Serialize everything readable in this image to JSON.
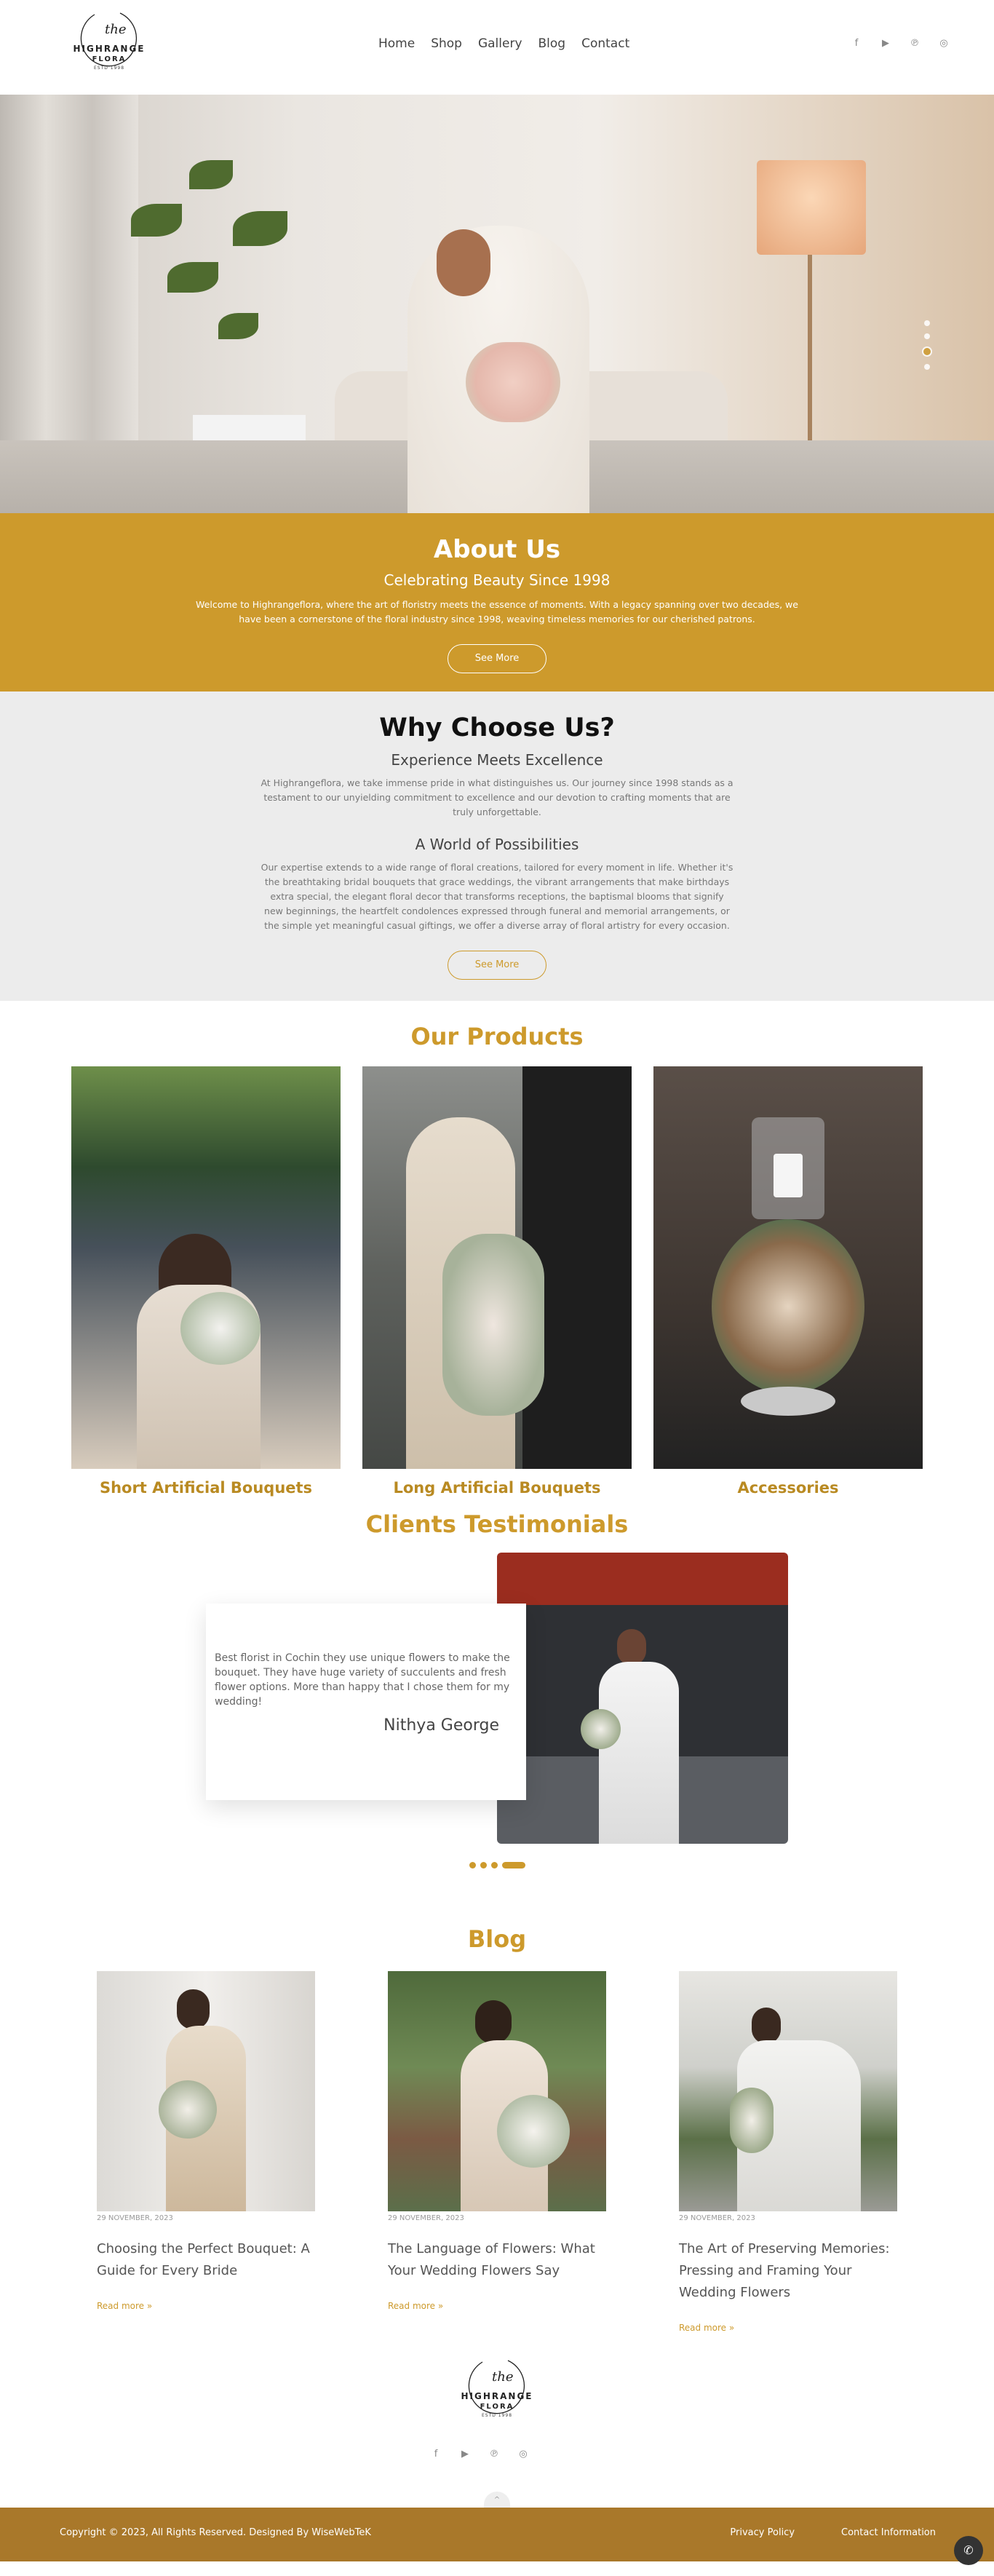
{
  "brand": {
    "line1": "HIGHRANGE",
    "line2": "FLORA",
    "line3": "ESTD 1998",
    "script": "the"
  },
  "nav": {
    "items": [
      "Home",
      "Shop",
      "Gallery",
      "Blog",
      "Contact"
    ]
  },
  "social": {
    "icons": [
      "facebook-icon",
      "youtube-icon",
      "pinterest-icon",
      "instagram-icon"
    ],
    "glyphs": [
      "f",
      "▶",
      "℗",
      "◎"
    ]
  },
  "hero": {
    "slides": 4,
    "active_slide": 3
  },
  "about": {
    "title": "About Us",
    "subtitle": "Celebrating Beauty Since 1998",
    "text": "Welcome to Highrangeflora, where the art of floristry meets the essence of moments. With a legacy spanning over two decades, we have been a cornerstone of the floral industry since 1998, weaving timeless memories for our cherished patrons.",
    "button": "See More"
  },
  "why": {
    "title": "Why Choose Us?",
    "sub1": "Experience Meets Excellence",
    "text1": "At Highrangeflora, we take immense pride in what distinguishes us. Our journey since 1998 stands as a testament to our unyielding commitment to excellence and our devotion to crafting moments that are truly unforgettable.",
    "sub2": "A World of Possibilities",
    "text2": "Our expertise extends to a wide range of floral creations, tailored for every moment in life. Whether it's the breathtaking bridal bouquets that grace weddings, the vibrant arrangements that make birthdays extra special, the elegant floral decor that transforms receptions, the baptismal blooms that signify new beginnings, the heartfelt condolences expressed through funeral and memorial arrangements, or the simple yet meaningful casual giftings, we offer a diverse array of floral artistry for every occasion.",
    "button": "See More"
  },
  "products": {
    "title": "Our Products",
    "items": [
      {
        "caption": "Short Artificial Bouquets"
      },
      {
        "caption": "Long Artificial Bouquets"
      },
      {
        "caption": "Accessories"
      }
    ]
  },
  "testimonials": {
    "title": "Clients Testimonials",
    "quote": "Best florist in Cochin they use unique flowers to make the bouquet. They have huge variety of succulents and fresh flower options. More than happy that I chose them for my wedding!",
    "name": "Nithya George",
    "dots": 4,
    "active_dot": 4
  },
  "blog": {
    "title": "Blog",
    "posts": [
      {
        "date": "29 NOVEMBER, 2023",
        "title": "Choosing the Perfect Bouquet: A Guide for Every Bride",
        "more": "Read more »"
      },
      {
        "date": "29 NOVEMBER, 2023",
        "title": "The Language of Flowers: What Your Wedding Flowers Say",
        "more": "Read more »"
      },
      {
        "date": "29 NOVEMBER, 2023",
        "title": "The Art of Preserving Memories: Pressing and Framing Your Wedding Flowers",
        "more": "Read more »"
      }
    ]
  },
  "footer": {
    "copyright": "Copyright © 2023, All Rights Reserved. Designed By WiseWebTeK",
    "links": [
      "Privacy Policy",
      "Contact Information"
    ],
    "to_top": "^"
  },
  "colors": {
    "accent": "#cd9a2c",
    "footer": "#a9782a",
    "why_bg": "#ececec"
  }
}
